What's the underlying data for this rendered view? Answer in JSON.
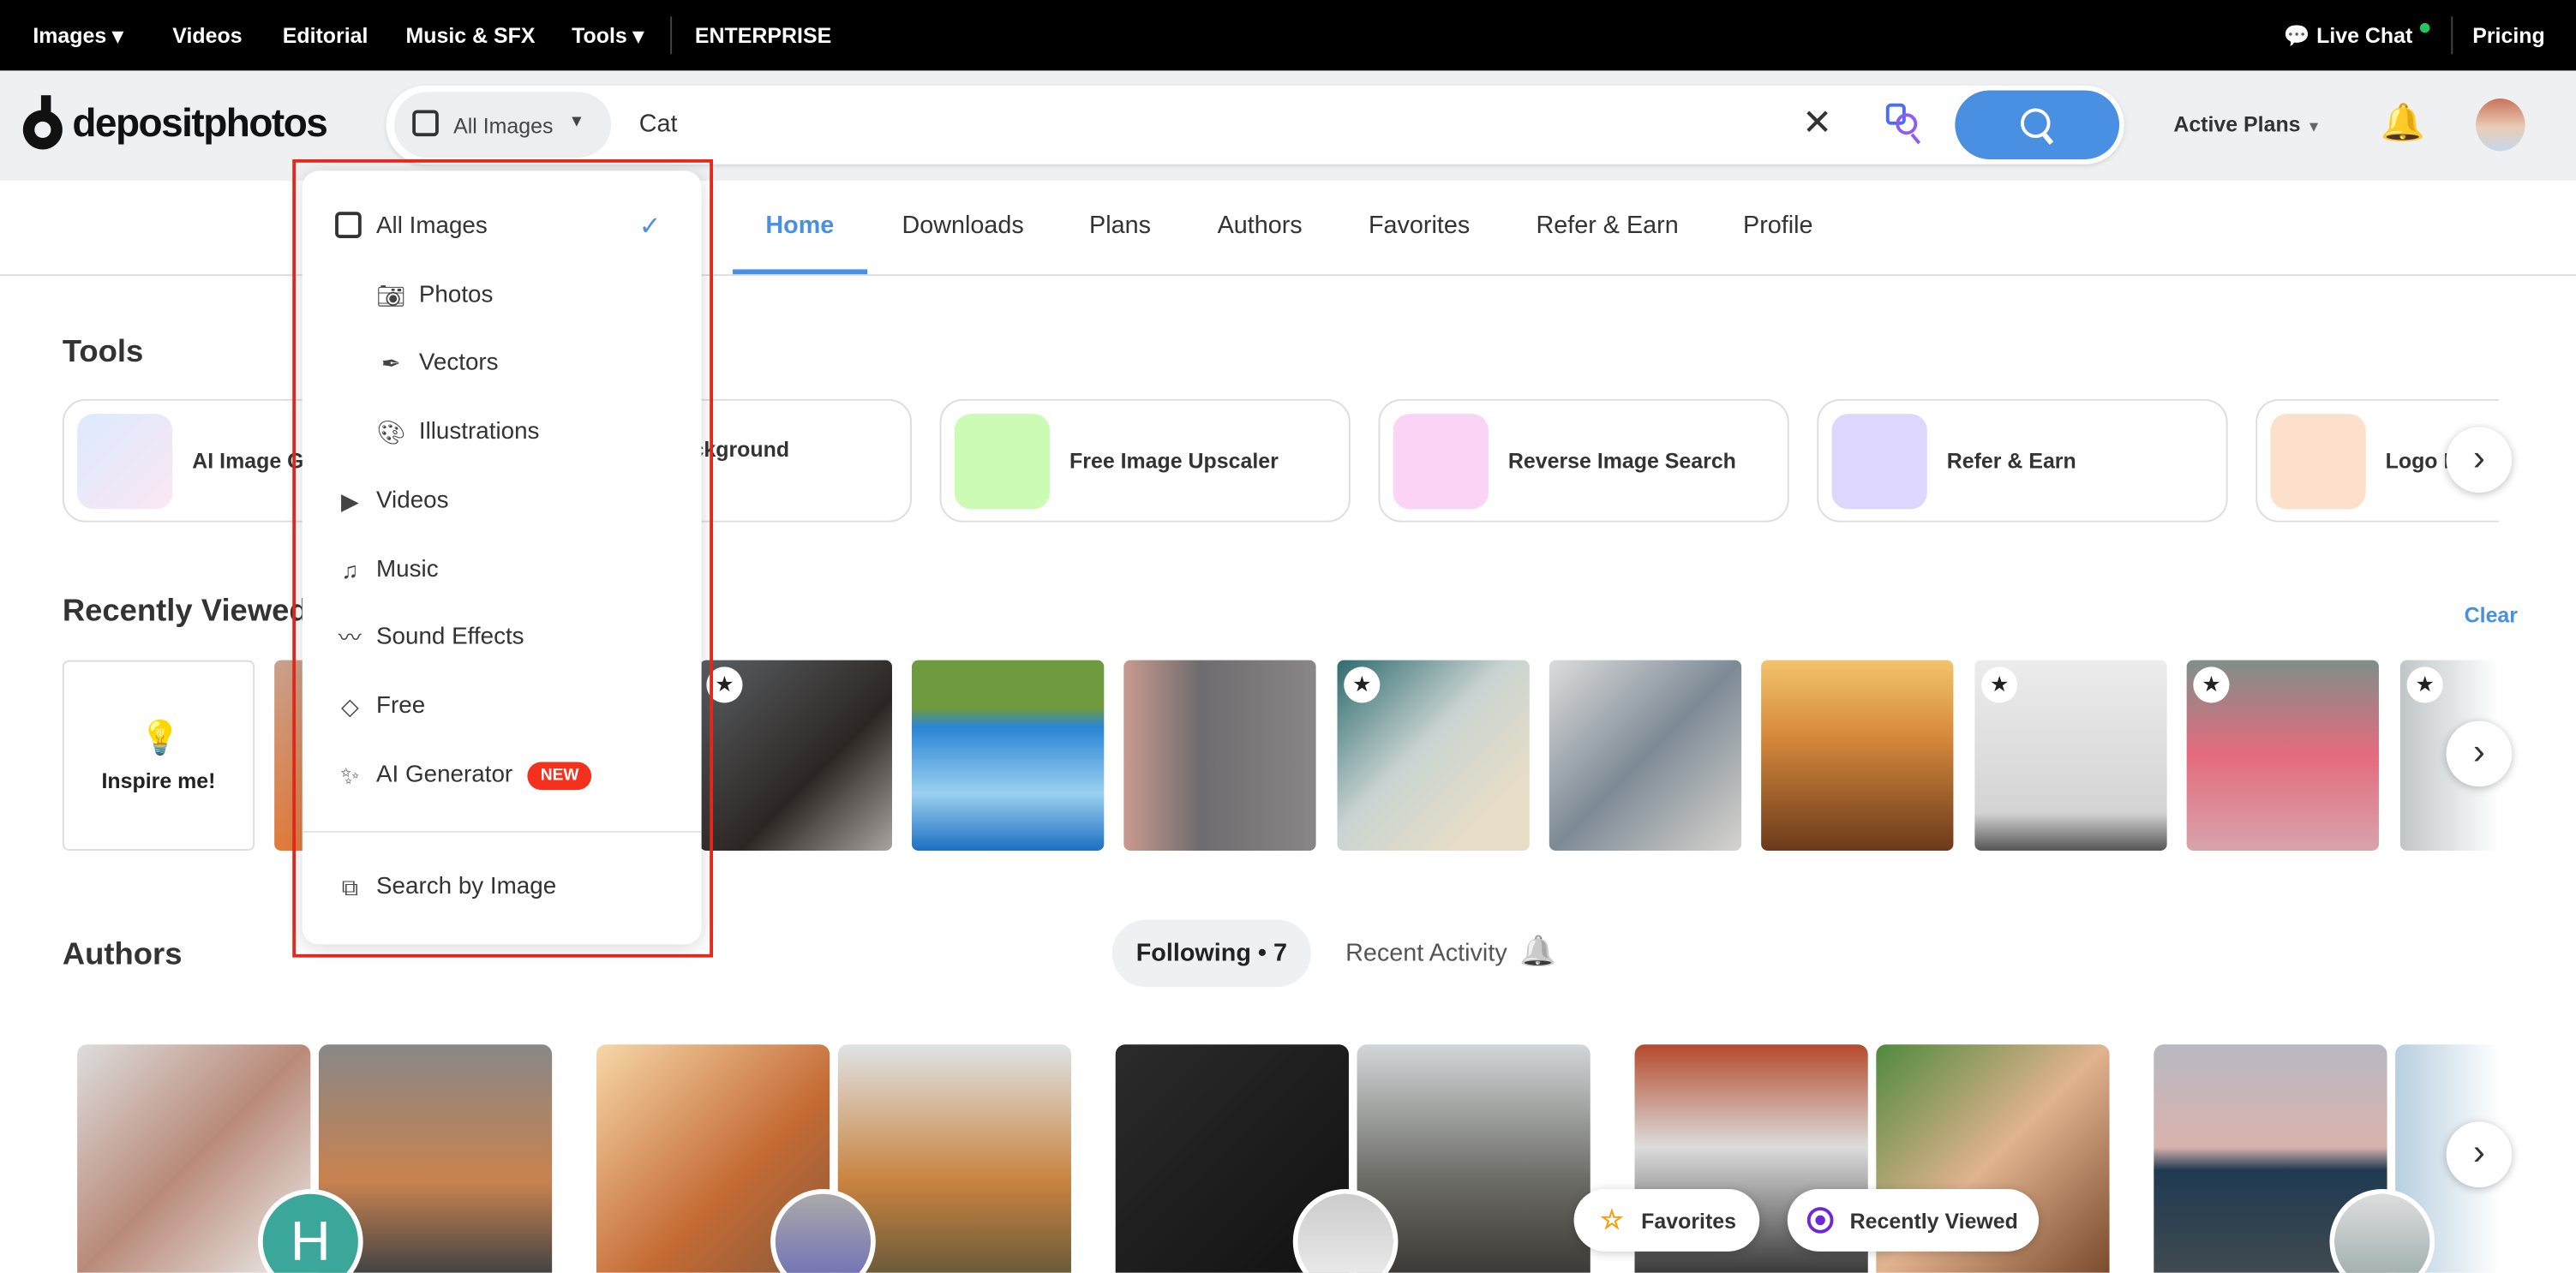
{
  "topbar": {
    "images": "Images ▾",
    "videos": "Videos",
    "editorial": "Editorial",
    "music": "Music & SFX",
    "tools": "Tools ▾",
    "enterprise": "ENTERPRISE",
    "live_chat": "Live Chat",
    "pricing": "Pricing"
  },
  "header": {
    "logo": "depositphotos",
    "type_select": "All Images",
    "query": "Cat",
    "active_plans": "Active Plans"
  },
  "nav": {
    "tabs": [
      "Home",
      "Downloads",
      "Plans",
      "Authors",
      "Favorites",
      "Refer & Earn",
      "Profile"
    ],
    "active": "Home"
  },
  "tools": {
    "title": "Tools",
    "items": [
      "AI Image Ge",
      "ackground",
      "er",
      "Free Image Upscaler",
      "Reverse Image Search",
      "Refer & Earn",
      "Logo I"
    ]
  },
  "recent": {
    "title": "Recently Viewed",
    "clear": "Clear",
    "inspire": "Inspire me!"
  },
  "authors": {
    "title": "Authors",
    "following": "Following • 7",
    "recent_activity": "Recent Activity",
    "avatar_letter": "H"
  },
  "dropdown": {
    "items": [
      "All Images",
      "Photos",
      "Vectors",
      "Illustrations",
      "Videos",
      "Music",
      "Sound Effects",
      "Free",
      "AI Generator"
    ],
    "new_badge": "NEW",
    "search_by_image": "Search by Image",
    "selected": "All Images"
  },
  "floating": {
    "favorites": "Favorites",
    "recently_viewed": "Recently Viewed"
  },
  "colors": {
    "accent": "#4a90e2",
    "highlight": "#e8281c",
    "new_badge": "#f5311e",
    "online": "#22c55e"
  }
}
